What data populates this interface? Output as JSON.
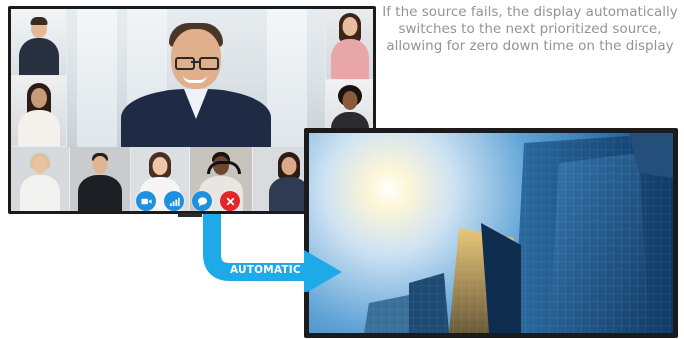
{
  "description": {
    "text": "If the source fails, the display automatically switches to the next prioritized source, allowing for zero down time on the display"
  },
  "transition": {
    "label": "AUTOMATIC"
  },
  "conference": {
    "controls": [
      {
        "name": "camera",
        "icon": "video-camera-icon",
        "color": "#1e90e0"
      },
      {
        "name": "signal",
        "icon": "signal-bars-icon",
        "color": "#1e90e0"
      },
      {
        "name": "chat",
        "icon": "chat-bubble-icon",
        "color": "#1e90e0"
      },
      {
        "name": "end-call",
        "icon": "close-icon",
        "color": "#e5242b"
      }
    ]
  },
  "colors": {
    "accent": "#1ea9e8",
    "text": "#8f949a",
    "bezel": "#1b1b1d",
    "end_call": "#e5242b"
  }
}
